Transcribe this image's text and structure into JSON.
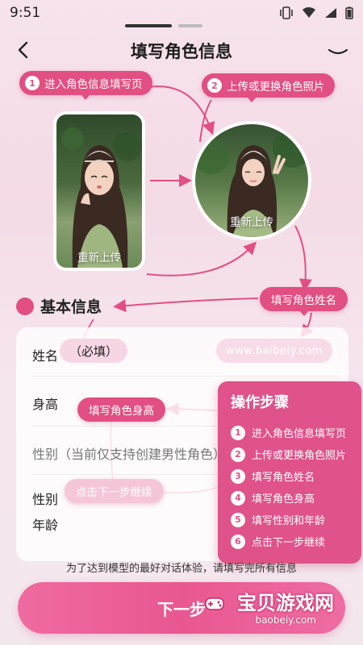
{
  "status": {
    "time": "9:51"
  },
  "header": {
    "title": "填写角色信息"
  },
  "callouts": {
    "step1": {
      "num": "1",
      "label": "进入角色信息填写页"
    },
    "step2": {
      "num": "2",
      "label": "上传或更换角色照片"
    },
    "name": "填写角色姓名",
    "height": "填写角色身高",
    "next": "点击下一步继续"
  },
  "photos": {
    "reupload_label": "重新上传"
  },
  "section": {
    "title": "基本信息"
  },
  "form": {
    "name_label": "姓名",
    "name_required": "（必填）",
    "watermark": "www.baibeiy.com",
    "height_label": "身高",
    "gender_label": "性别（当前仅支持创建男性角色）",
    "gender_short": "性别",
    "age_label": "年龄"
  },
  "steps_panel": {
    "title": "操作步骤",
    "items": [
      {
        "num": "1",
        "label": "进入角色信息填写页"
      },
      {
        "num": "2",
        "label": "上传或更换角色照片"
      },
      {
        "num": "3",
        "label": "填写角色姓名"
      },
      {
        "num": "4",
        "label": "填写角色身高"
      },
      {
        "num": "5",
        "label": "填写性别和年龄"
      },
      {
        "num": "6",
        "label": "点击下一步继续"
      }
    ]
  },
  "footer": {
    "note": "为了达到模型的最好对话体验，请填写完所有信息",
    "next_button": "下一步",
    "brand": "宝贝游戏网",
    "brand_url": "baobeiy.com"
  },
  "colors": {
    "accent": "#e24f82",
    "button": "#e95790"
  }
}
